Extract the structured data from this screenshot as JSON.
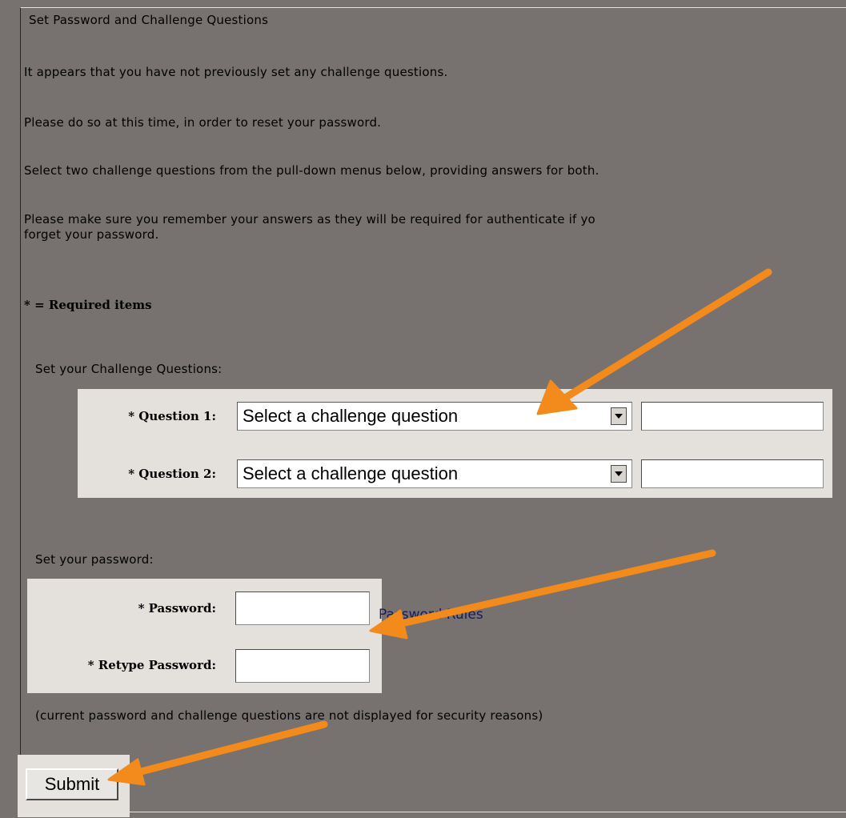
{
  "form": {
    "legend": "Set Password and Challenge Questions",
    "intro": [
      "It appears that you have not previously set any challenge questions.",
      "Please do so at this time, in order to reset your password.",
      "Select two challenge questions from the pull-down menus below, providing answers for both.",
      "Please make sure you remember your answers as they will be required for authenticate if yo",
      "forget your password."
    ],
    "required_note": "* = Required items"
  },
  "challenge": {
    "section_label": "Set your Challenge Questions:",
    "question1_label": "* Question 1:",
    "question1_value": "Select a challenge question",
    "answer1_value": "",
    "question2_label": "* Question 2:",
    "question2_value": "Select a challenge question",
    "answer2_value": ""
  },
  "password": {
    "section_label": "Set your password:",
    "password_label": "* Password:",
    "password_value": "",
    "retype_label": "* Retype Password:",
    "retype_value": "",
    "rules_link": "Password Rules"
  },
  "security_note": "(current password and challenge questions are not displayed for security reasons)",
  "submit_label": "Submit",
  "annotation_color": "#f28a1c"
}
